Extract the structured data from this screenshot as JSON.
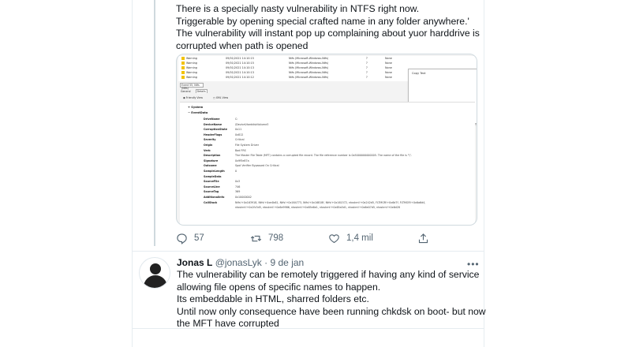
{
  "tweet1": {
    "lines": [
      "There is a specially nasty vulnerability in NTFS right now.",
      "Triggerable by opening special crafted name in any folder anywhere.'",
      "The vulnerability will instant pop up complaining about yuor harddrive is",
      "corrupted when path is opened"
    ],
    "actions": {
      "reply_count": "57",
      "retweet_count": "798",
      "like_count": "1,4 mil"
    }
  },
  "screenshot": {
    "rows": [
      {
        "level": "Warning",
        "date": "09/01/2021 14:10:15",
        "source": "Ntfs (Microsoft-Windows-Ntfs)",
        "id": "?",
        "cat": "None"
      },
      {
        "level": "Warning",
        "date": "09/01/2021 14:10:15",
        "source": "Ntfs (Microsoft-Windows-Ntfs)",
        "id": "?",
        "cat": "None"
      },
      {
        "level": "Warning",
        "date": "09/01/2021 14:10:13",
        "source": "Ntfs (Microsoft-Windows-Ntfs)",
        "id": "?",
        "cat": "None"
      },
      {
        "level": "Warning",
        "date": "09/01/2021 14:10:13",
        "source": "Ntfs (Microsoft-Windows-Ntfs)",
        "id": "?",
        "cat": "None"
      },
      {
        "level": "Warning",
        "date": "09/01/2021 14:10:12",
        "source": "Ntfs (Microsoft-Windows-Ntfs)",
        "id": "?",
        "cat": "None"
      }
    ],
    "context_menu_item": "Copy Text",
    "event_title": "Event 55, Ntfs (Ntfs)",
    "tabs": [
      "General",
      "Details"
    ],
    "view_options": [
      "Friendly View",
      "XML View"
    ],
    "sections": [
      "System",
      "EventData"
    ],
    "fields": [
      {
        "k": "DriveName",
        "v": "C:"
      },
      {
        "k": "DeviceName",
        "v": "\\Device\\HarddiskVolume3"
      },
      {
        "k": "CorruptionState",
        "v": "0x11"
      },
      {
        "k": "HeaderFlags",
        "v": "0x812"
      },
      {
        "k": "Severity",
        "v": "Critical"
      },
      {
        "k": "Origin",
        "v": "File System Driver"
      },
      {
        "k": "Verb",
        "v": "Bad FRS"
      },
      {
        "k": "Description",
        "v": "The Master File Table (MFT) contains a corrupted file record. The file reference number is 0x5000000000005. The name of the file is \"\\\"."
      },
      {
        "k": "Signature",
        "v": "0x9f5e87a"
      },
      {
        "k": "Outcome",
        "v": "Spot Verifier Bypassed On Critical"
      },
      {
        "k": "SampleLength",
        "v": "0"
      },
      {
        "k": "SampleData",
        "v": ""
      },
      {
        "k": "SourceFile",
        "v": "0x3"
      },
      {
        "k": "SourceLine",
        "v": "746"
      },
      {
        "k": "SourceTag",
        "v": "369"
      },
      {
        "k": "AdditionalInfo",
        "v": "0x10000002"
      },
      {
        "k": "CallStack",
        "v": "Ntfs!+0x163918, Ntfs!+0xe4b61, Ntfs!+0x164773, Ntfs!+0x16818f, Ntfs!+0x161572, ntoskrnl!+0x242d5, FLTMGR!+0x6d7f, FLTMGR!+0x6a6d4,"
      },
      {
        "k": "",
        "v": "ntoskrnl!+0x2fc3d5, ntoskrnl!+0x6e9986, ntoskrnl!+0x65e6e1, ntoskrnl!+0x65a5d1, ntoskrnl!+0x6e07d5, ntoskrnl!+0x6d28"
      }
    ]
  },
  "tweet2": {
    "name": "Jonas L",
    "handle": "@jonasLyk",
    "separator": "·",
    "date": "9 de jan",
    "more": "•••",
    "lines": [
      "The vulnerability can be remotely triggered if having any kind of service",
      "allowing file opens of specific names to happen.",
      "Its embeddable in HTML, sharred folders etc.",
      "Until now only consequence have been running chkdsk on boot- but now",
      "the MFT have corrupted"
    ]
  },
  "icons": {
    "reply": "reply-icon",
    "retweet": "retweet-icon",
    "like": "like-icon",
    "share": "share-icon",
    "warning": "warning-icon"
  },
  "colors": {
    "text": "#0f1419",
    "muted": "#536471",
    "border": "#e6ecf0",
    "warning": "#f2c200"
  }
}
